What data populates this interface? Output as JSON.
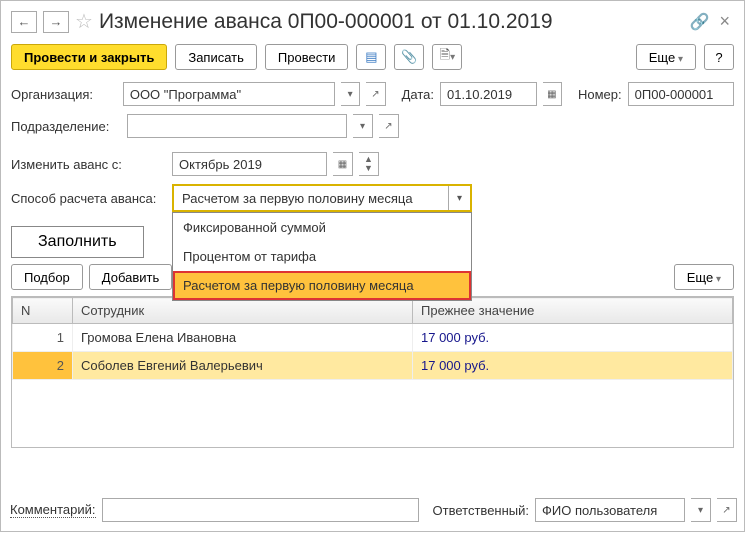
{
  "header": {
    "title": "Изменение аванса 0П00-000001 от 01.10.2019"
  },
  "toolbar": {
    "post_close": "Провести и закрыть",
    "save": "Записать",
    "post": "Провести",
    "more": "Еще",
    "help": "?"
  },
  "fields": {
    "org_label": "Организация:",
    "org_value": "ООО \"Программа\"",
    "date_label": "Дата:",
    "date_value": "01.10.2019",
    "num_label": "Номер:",
    "num_value": "0П00-000001",
    "dept_label": "Подразделение:",
    "dept_value": "",
    "change_from_label": "Изменить аванс с:",
    "change_from_value": "Октябрь 2019",
    "calc_label": "Способ расчета аванса:",
    "calc_value": "Расчетом за первую половину месяца",
    "calc_options": [
      "Фиксированной суммой",
      "Процентом от тарифа",
      "Расчетом за первую половину месяца"
    ]
  },
  "buttons": {
    "fill": "Заполнить",
    "pick": "Подбор",
    "add": "Добавить",
    "more2": "Еще"
  },
  "table": {
    "cols": {
      "n": "N",
      "emp": "Сотрудник",
      "prev": "Прежнее значение"
    },
    "rows": [
      {
        "n": "1",
        "emp": "Громова Елена Ивановна",
        "prev": "17 000 руб."
      },
      {
        "n": "2",
        "emp": "Соболев Евгений Валерьевич",
        "prev": "17 000 руб."
      }
    ]
  },
  "footer": {
    "comment_label": "Комментарий:",
    "comment_value": "",
    "resp_label": "Ответственный:",
    "resp_value": "ФИО пользователя"
  }
}
